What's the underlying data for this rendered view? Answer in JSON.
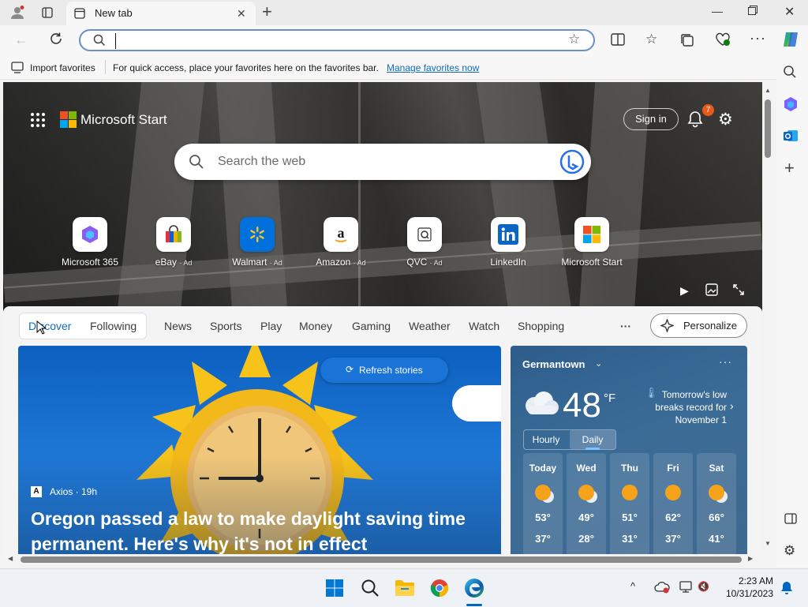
{
  "browser": {
    "tab_title": "New tab",
    "address_value": "",
    "favorites_bar": {
      "import_label": "Import favorites",
      "message": "For quick access, place your favorites here on the favorites bar.",
      "manage_link": "Manage favorites now"
    }
  },
  "start": {
    "brand": "Microsoft Start",
    "sign_in": "Sign in",
    "notifications_count": "7",
    "search_placeholder": "Search the web",
    "tiles": [
      {
        "label": "Microsoft 365",
        "ad": ""
      },
      {
        "label": "eBay",
        "ad": "· Ad"
      },
      {
        "label": "Walmart",
        "ad": "· Ad"
      },
      {
        "label": "Amazon",
        "ad": "· Ad"
      },
      {
        "label": "QVC",
        "ad": "· Ad"
      },
      {
        "label": "LinkedIn",
        "ad": ""
      },
      {
        "label": "Microsoft Start",
        "ad": ""
      }
    ],
    "nav": {
      "discover": "Discover",
      "following": "Following",
      "items": [
        "News",
        "Sports",
        "Play",
        "Money",
        "Gaming",
        "Weather",
        "Watch",
        "Shopping"
      ],
      "more": "···",
      "personalize": "Personalize"
    },
    "story": {
      "refresh": "Refresh stories",
      "source": "Axios · 19h",
      "headline_line1": "Oregon passed a law to make daylight saving time",
      "headline_line2": "permanent. Here's why it's not in effect"
    },
    "weather": {
      "location": "Germantown",
      "temp": "48",
      "unit": "°F",
      "alert_line1": "Tomorrow's low",
      "alert_line2": "breaks record for",
      "alert_line3": "November 1",
      "tab_hourly": "Hourly",
      "tab_daily": "Daily",
      "days": [
        {
          "name": "Today",
          "high": "53°",
          "low": "37°"
        },
        {
          "name": "Wed",
          "high": "49°",
          "low": "28°"
        },
        {
          "name": "Thu",
          "high": "51°",
          "low": "31°"
        },
        {
          "name": "Fri",
          "high": "62°",
          "low": "37°"
        },
        {
          "name": "Sat",
          "high": "66°",
          "low": "41°"
        }
      ]
    }
  },
  "taskbar": {
    "time": "2:23 AM",
    "date": "10/31/2023"
  },
  "colors": {
    "accent": "#0f6cbd",
    "link": "#0f6cbd",
    "badge": "#e8591a"
  }
}
